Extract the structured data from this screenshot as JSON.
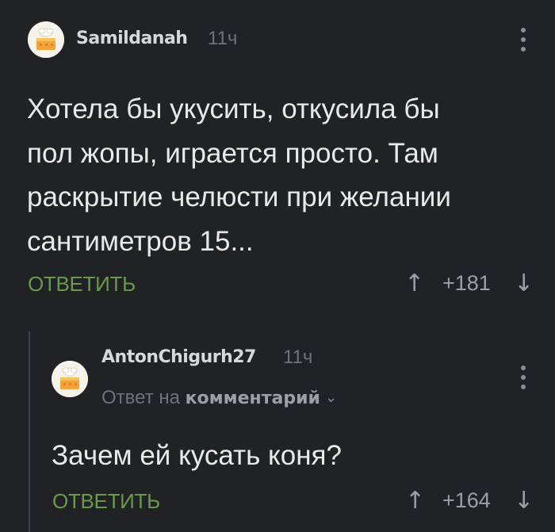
{
  "comment": {
    "username": "Samildanah",
    "time": "11ч",
    "avatar_icon": "cake-avatar-icon",
    "menu_icon": "more-vertical-icon",
    "text_lines": [
      "Хотела бы укусить, откусила бы",
      "пол жопы, играется просто. Там",
      "раскрытие челюсти при желании",
      "сантиметров 15..."
    ],
    "reply_label": "ОТВЕТИТЬ",
    "upvote_icon": "↑",
    "score": "+181",
    "downvote_icon": "↓"
  },
  "reply": {
    "username": "AntonChigurh27",
    "time": "11ч",
    "avatar_icon": "cake-avatar-icon",
    "menu_icon": "more-vertical-icon",
    "reply_to_prefix": "Ответ на",
    "reply_to_link": "комментарий",
    "reply_to_chevron": "⌄",
    "text": "Зачем ей кусать коня?",
    "reply_label": "ОТВЕТИТЬ",
    "upvote_icon": "↑",
    "score": "+164",
    "downvote_icon": "↓"
  },
  "colors": {
    "background": "#202225",
    "accent_green": "#6a9a49",
    "text": "#e8e9ea",
    "muted": "#6e7379"
  }
}
